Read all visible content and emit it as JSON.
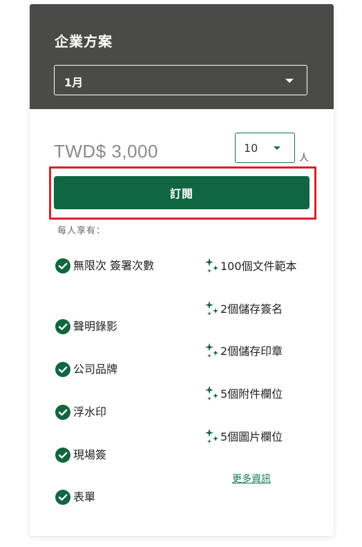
{
  "plan": {
    "title": "企業方案",
    "period": {
      "selected": "1月"
    },
    "price": "TWD$ 3,000",
    "quantity": {
      "selected": "10",
      "unit": "人"
    },
    "subscribe_label": "訂閱",
    "per_person_label": "每人享有："
  },
  "features": [
    {
      "label": "無限次 簽署次數",
      "icon": "check-circle-icon"
    },
    {
      "label": "聲明錄影",
      "icon": "check-circle-icon"
    },
    {
      "label": "公司品牌",
      "icon": "check-circle-icon"
    },
    {
      "label": "浮水印",
      "icon": "check-circle-icon"
    },
    {
      "label": "現場簽",
      "icon": "check-circle-icon"
    },
    {
      "label": "表單",
      "icon": "check-circle-icon"
    }
  ],
  "extras": [
    {
      "label": "100個文件範本",
      "icon": "sparkle-icon"
    },
    {
      "label": "2個儲存簽名",
      "icon": "sparkle-icon"
    },
    {
      "label": "2個儲存印章",
      "icon": "sparkle-icon"
    },
    {
      "label": "5個附件欄位",
      "icon": "sparkle-icon"
    },
    {
      "label": "5個圖片欄位",
      "icon": "sparkle-icon"
    }
  ],
  "more_link_label": "更多資訊",
  "colors": {
    "header_bg": "#4a4a48",
    "brand_green": "#0f6641",
    "highlight_red": "#d92027"
  }
}
